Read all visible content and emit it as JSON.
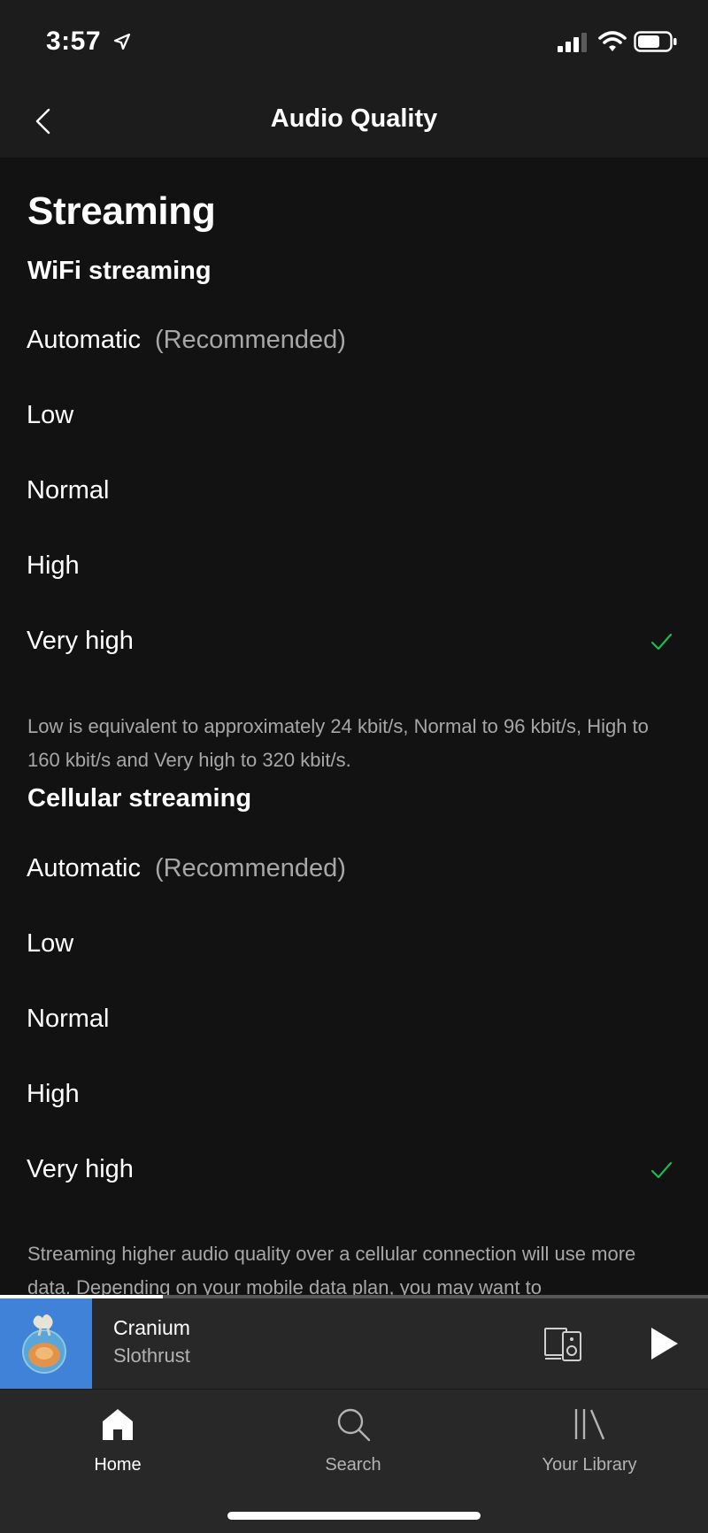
{
  "status_bar": {
    "time": "3:57"
  },
  "header": {
    "title": "Audio Quality"
  },
  "streaming": {
    "title": "Streaming",
    "wifi": {
      "title": "WiFi streaming",
      "options": [
        {
          "label": "Automatic",
          "note": "(Recommended)",
          "selected": false
        },
        {
          "label": "Low",
          "note": "",
          "selected": false
        },
        {
          "label": "Normal",
          "note": "",
          "selected": false
        },
        {
          "label": "High",
          "note": "",
          "selected": false
        },
        {
          "label": "Very high",
          "note": "",
          "selected": true
        }
      ],
      "description": "Low is equivalent to approximately 24 kbit/s, Normal to 96 kbit/s, High to 160 kbit/s and Very high to 320 kbit/s."
    },
    "cellular": {
      "title": "Cellular streaming",
      "options": [
        {
          "label": "Automatic",
          "note": "(Recommended)",
          "selected": false
        },
        {
          "label": "Low",
          "note": "",
          "selected": false
        },
        {
          "label": "Normal",
          "note": "",
          "selected": false
        },
        {
          "label": "High",
          "note": "",
          "selected": false
        },
        {
          "label": "Very high",
          "note": "",
          "selected": true
        }
      ],
      "description": "Streaming higher audio quality over a cellular connection will use more data. Depending on your mobile data plan, you may want to"
    }
  },
  "now_playing": {
    "title": "Cranium",
    "artist": "Slothrust",
    "progress": 0.23
  },
  "nav": {
    "items": [
      {
        "label": "Home",
        "icon": "home-icon",
        "active": true
      },
      {
        "label": "Search",
        "icon": "search-icon",
        "active": false
      },
      {
        "label": "Your Library",
        "icon": "library-icon",
        "active": false
      }
    ]
  },
  "colors": {
    "background": "#121212",
    "header": "#1c1c1c",
    "accent_green": "#1db954",
    "secondary_text": "#a7a7a7",
    "player_bg": "#282828"
  }
}
